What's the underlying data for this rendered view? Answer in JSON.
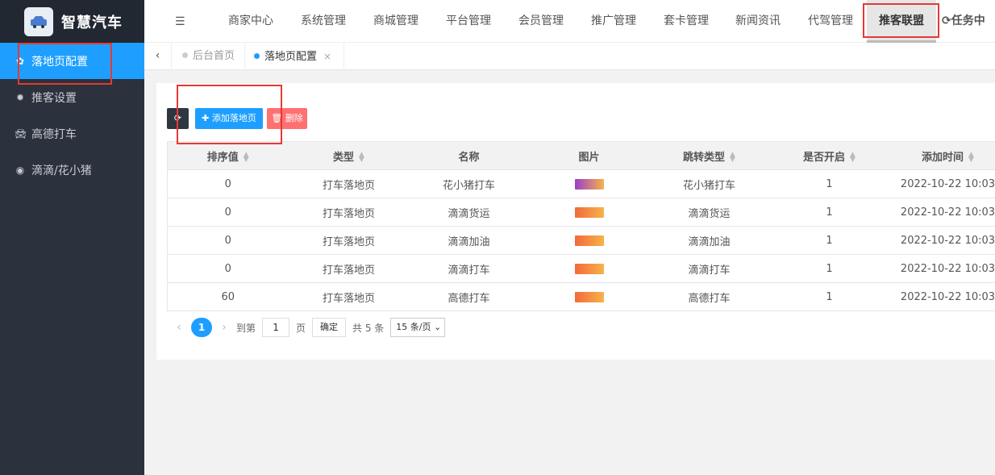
{
  "app": {
    "title": "智慧汽车"
  },
  "sidebar": {
    "items": [
      {
        "label": "落地页配置",
        "icon": "gear-icon"
      },
      {
        "label": "推客设置",
        "icon": "sun-icon"
      },
      {
        "label": "高德打车",
        "icon": "car-icon"
      },
      {
        "label": "滴滴/花小猪",
        "icon": "circle-icon"
      }
    ]
  },
  "topnav": {
    "items": [
      "商家中心",
      "系统管理",
      "商城管理",
      "平台管理",
      "会员管理",
      "推广管理",
      "套卡管理",
      "新闻资讯",
      "代驾管理",
      "推客联盟",
      "任务中心"
    ]
  },
  "tabs": {
    "back": "‹",
    "items": [
      {
        "label": "后台首页"
      },
      {
        "label": "落地页配置",
        "close": "×"
      }
    ]
  },
  "toolbar": {
    "refresh": "⟳",
    "add_label": "✚ 添加落地页",
    "delete_label": "🗑 删除"
  },
  "table": {
    "headers": [
      "排序值",
      "类型",
      "名称",
      "图片",
      "跳转类型",
      "是否开启",
      "添加时间"
    ],
    "rows": [
      {
        "sort": "0",
        "type": "打车落地页",
        "name": "花小猪打车",
        "img_color": "#9b3fc9",
        "jump": "花小猪打车",
        "enabled": "1",
        "time": "2022-10-22 10:03"
      },
      {
        "sort": "0",
        "type": "打车落地页",
        "name": "滴滴货运",
        "img_color": "#f26a3b",
        "jump": "滴滴货运",
        "enabled": "1",
        "time": "2022-10-22 10:03"
      },
      {
        "sort": "0",
        "type": "打车落地页",
        "name": "滴滴加油",
        "img_color": "#f26a3b",
        "jump": "滴滴加油",
        "enabled": "1",
        "time": "2022-10-22 10:03"
      },
      {
        "sort": "0",
        "type": "打车落地页",
        "name": "滴滴打车",
        "img_color": "#f26a3b",
        "jump": "滴滴打车",
        "enabled": "1",
        "time": "2022-10-22 10:03"
      },
      {
        "sort": "60",
        "type": "打车落地页",
        "name": "高德打车",
        "img_color": "#f26a3b",
        "jump": "高德打车",
        "enabled": "1",
        "time": "2022-10-22 10:03"
      }
    ]
  },
  "pager": {
    "prev": "‹",
    "current": "1",
    "next": "›",
    "goto_label": "到第",
    "goto_value": "1",
    "page_unit": "页",
    "confirm": "确定",
    "total": "共 5 条",
    "page_size": "15 条/页"
  },
  "colors": {
    "accent": "#1e9fff",
    "sidebar": "#2b323d",
    "danger": "#ff7070",
    "highlight": "#e53935"
  }
}
